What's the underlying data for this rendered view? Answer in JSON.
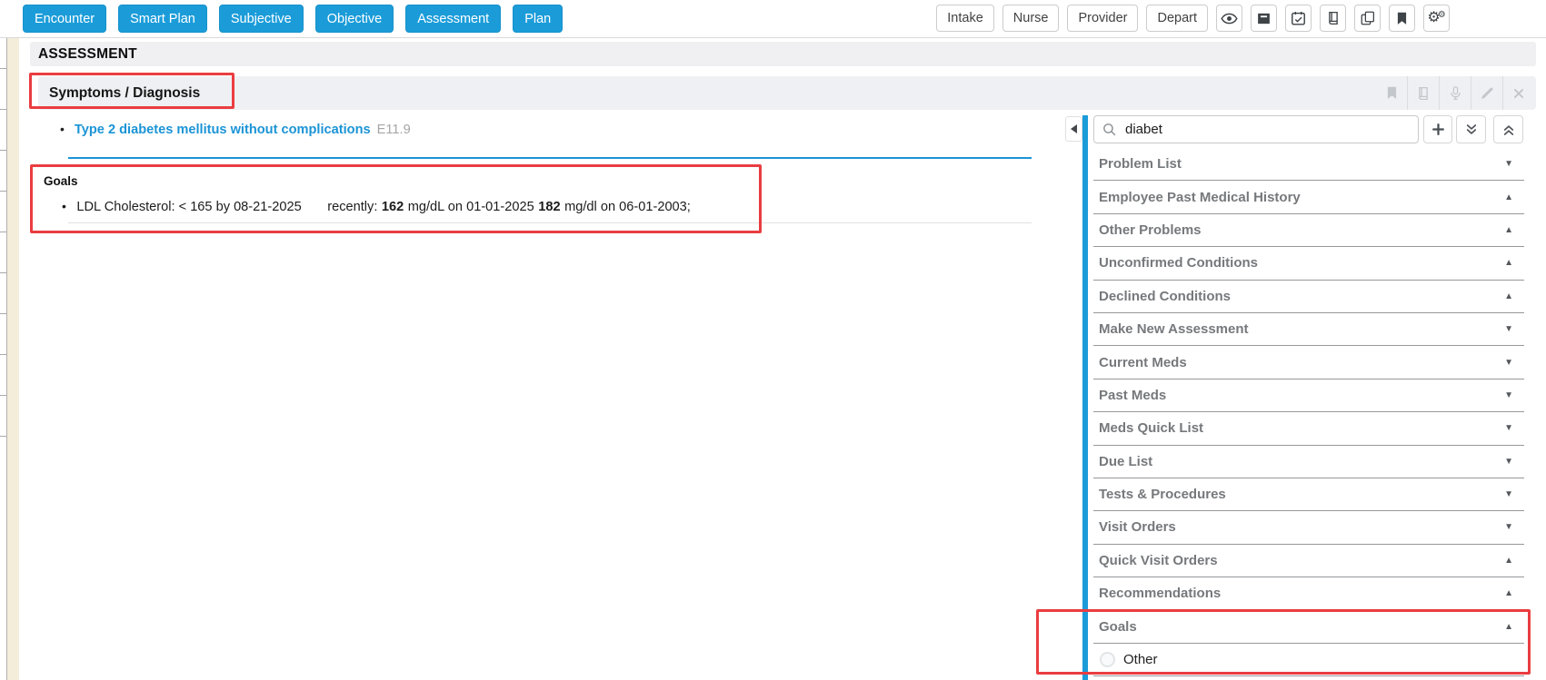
{
  "colors": {
    "accent_blue": "#1b9cd9",
    "annotation_red": "#ea3d40",
    "link_blue": "#1b94d6"
  },
  "toolbar": {
    "nav_buttons": [
      "Encounter",
      "Smart Plan",
      "Subjective",
      "Objective",
      "Assessment",
      "Plan"
    ],
    "stage_buttons": [
      "Intake",
      "Nurse",
      "Provider",
      "Depart"
    ],
    "icon_buttons": [
      "eye",
      "archive",
      "calendar-check",
      "book",
      "copy",
      "bookmark",
      "settings-gears"
    ]
  },
  "assessment": {
    "page_title": "ASSESSMENT",
    "section": {
      "title": "Symptoms / Diagnosis",
      "header_icons": [
        "bookmark",
        "book",
        "microphone",
        "pencil",
        "close"
      ]
    },
    "diagnosis": {
      "label": "Type 2 diabetes mellitus without complications",
      "code": "E11.9"
    },
    "goals": {
      "heading": "Goals",
      "goal": {
        "target": "LDL Cholesterol: < 165 by 08-21-2025",
        "recently_label": "recently:",
        "value_1": "162",
        "detail_1": "mg/dL on 01-01-2025",
        "value_2": "182",
        "detail_2": "mg/dl on 06-01-2003;"
      }
    }
  },
  "sidebar": {
    "search_value": "diabet",
    "sections": [
      {
        "label": "Problem List",
        "chevron": "down"
      },
      {
        "label": "Employee Past Medical History",
        "chevron": "up"
      },
      {
        "label": "Other Problems",
        "chevron": "up"
      },
      {
        "label": "Unconfirmed Conditions",
        "chevron": "up"
      },
      {
        "label": "Declined Conditions",
        "chevron": "up"
      },
      {
        "label": "Make New Assessment",
        "chevron": "down"
      },
      {
        "label": "Current Meds",
        "chevron": "down"
      },
      {
        "label": "Past Meds",
        "chevron": "down"
      },
      {
        "label": "Meds Quick List",
        "chevron": "down"
      },
      {
        "label": "Due List",
        "chevron": "down"
      },
      {
        "label": "Tests & Procedures",
        "chevron": "down"
      },
      {
        "label": "Visit Orders",
        "chevron": "down"
      },
      {
        "label": "Quick Visit Orders",
        "chevron": "up"
      },
      {
        "label": "Recommendations",
        "chevron": "up"
      },
      {
        "label": "Goals",
        "chevron": "up"
      }
    ],
    "option_label": "Other"
  }
}
